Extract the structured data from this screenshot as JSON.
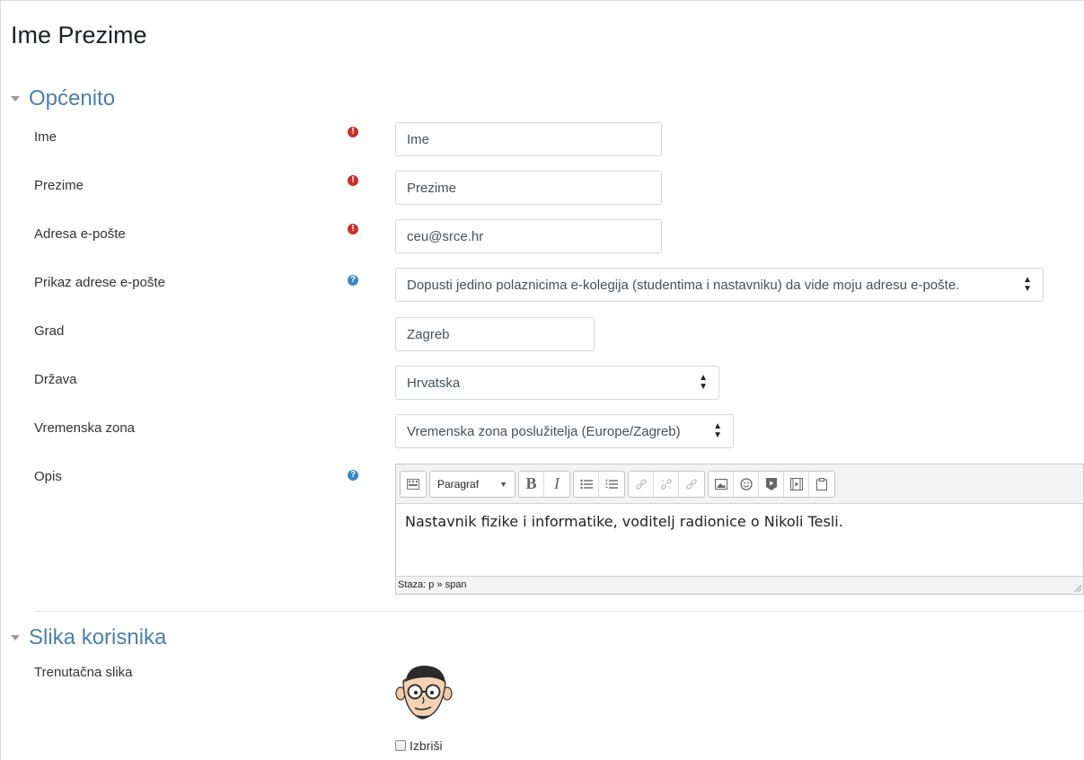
{
  "page": {
    "title": "Ime Prezime"
  },
  "sections": {
    "general": "Općenito",
    "picture": "Slika korisnika"
  },
  "fields": {
    "firstname": {
      "label": "Ime",
      "value": "Ime"
    },
    "lastname": {
      "label": "Prezime",
      "value": "Prezime"
    },
    "email": {
      "label": "Adresa e-pošte",
      "value": "ceu@srce.hr"
    },
    "maildisplay": {
      "label": "Prikaz adrese e-pošte",
      "value": "Dopusti jedino polaznicima e-kolegija (studentima i nastavniku) da vide moju adresu e-pošte."
    },
    "city": {
      "label": "Grad",
      "value": "Zagreb"
    },
    "country": {
      "label": "Država",
      "value": "Hrvatska"
    },
    "timezone": {
      "label": "Vremenska zona",
      "value": "Vremenska zona poslužitelja (Europe/Zagreb)"
    },
    "description": {
      "label": "Opis",
      "value": "Nastavnik fizike i informatike, voditelj radionice o Nikoli Tesli."
    },
    "current_picture": {
      "label": "Trenutačna slika"
    },
    "delete_picture": {
      "label": "Izbriši"
    }
  },
  "editor": {
    "paragraph_label": "Paragraf",
    "bold": "B",
    "italic": "I",
    "path": "Staza: p » span"
  },
  "icons": {
    "required": "exclamation-circle",
    "help": "question-circle"
  },
  "colors": {
    "section_title": "#4e7fa7",
    "required_icon": "#c9302c",
    "help_icon": "#3a87c8"
  }
}
